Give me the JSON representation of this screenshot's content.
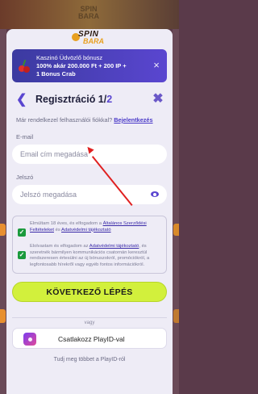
{
  "background": {
    "logo_line1": "SPIN",
    "logo_line2": "BARA"
  },
  "modal": {
    "brand_line1": "SPIN",
    "brand_line2": "BARA",
    "bonus": {
      "line1": "Kaszinó Üdvözlő bónusz",
      "line2": "100% akár 200.000 Ft + 200 IP +",
      "line3": "1 Bonus Crab",
      "icon": "cherry-icon",
      "close_icon": "close-icon"
    },
    "title": {
      "prefix": "Regisztráció 1/",
      "total": "2",
      "back_icon": "chevron-left-icon",
      "close_icon": "close-icon"
    },
    "login_hint": {
      "text": "Már rendelkezel felhasználói fiókkal?",
      "link": "Bejelentkezés"
    },
    "email": {
      "label": "E-mail",
      "placeholder": "Email cím megadása"
    },
    "password": {
      "label": "Jelszó",
      "placeholder": "Jelszó megadása",
      "eye_icon": "eye-icon"
    },
    "consents": [
      {
        "checked": true,
        "text_before": "Elmúltam 18 éves, és elfogadom a",
        "link1": "Általános Szerződési Feltételeket",
        "text_mid": "és",
        "link2": "Adatvédelmi tájékoztató",
        "text_after": ""
      },
      {
        "checked": true,
        "text_before": "Elolvastam és elfogadom az",
        "link1": "Adatvédelmi tájékoztató",
        "text_mid": ", és szeretnék bármilyen kommunikációs csatornán keresztül rendszeresen értesülni az új bónuszokról, promóciókról, a legfontosabb hírekről vagy egyéb fontos információkról.",
        "link2": "",
        "text_after": ""
      }
    ],
    "next_button": "KÖVETKEZŐ LÉPÉS",
    "divider": "vagy",
    "playid_button": "Csatlakozz PlayID-val",
    "more_info": "Tudj meg többet a PlayID-ról"
  },
  "colors": {
    "accent": "#5a46d0",
    "cta": "#d2f03c",
    "check": "#1a9a3c",
    "annotation_arrow": "#e02020"
  }
}
